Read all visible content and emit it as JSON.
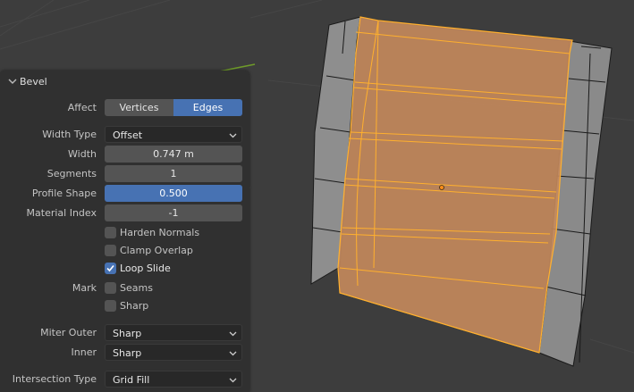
{
  "panel": {
    "title": "Bevel",
    "affect": {
      "label": "Affect",
      "options": [
        "Vertices",
        "Edges"
      ],
      "selected": "Edges"
    },
    "width_type": {
      "label": "Width Type",
      "value": "Offset"
    },
    "width": {
      "label": "Width",
      "value": "0.747 m"
    },
    "segments": {
      "label": "Segments",
      "value": "1"
    },
    "profile_shape": {
      "label": "Profile Shape",
      "value": "0.500",
      "fill_fraction": 0.5
    },
    "material_index": {
      "label": "Material Index",
      "value": "-1"
    },
    "harden_normals": {
      "label": "Harden Normals",
      "checked": false
    },
    "clamp_overlap": {
      "label": "Clamp Overlap",
      "checked": false
    },
    "loop_slide": {
      "label": "Loop Slide",
      "checked": true
    },
    "mark": {
      "label": "Mark",
      "seams_label": "Seams",
      "seams_checked": false,
      "sharp_label": "Sharp",
      "sharp_checked": false
    },
    "miter_outer": {
      "label": "Miter Outer",
      "value": "Sharp"
    },
    "miter_inner": {
      "label": "Inner",
      "value": "Sharp"
    },
    "intersection_type": {
      "label": "Intersection Type",
      "value": "Grid Fill"
    }
  },
  "colors": {
    "viewport_bg": "#3d3d3d",
    "panel_bg": "#303030",
    "accent": "#4772b3",
    "selection": "#ffa726",
    "axis_green": "#6f9b2a"
  }
}
